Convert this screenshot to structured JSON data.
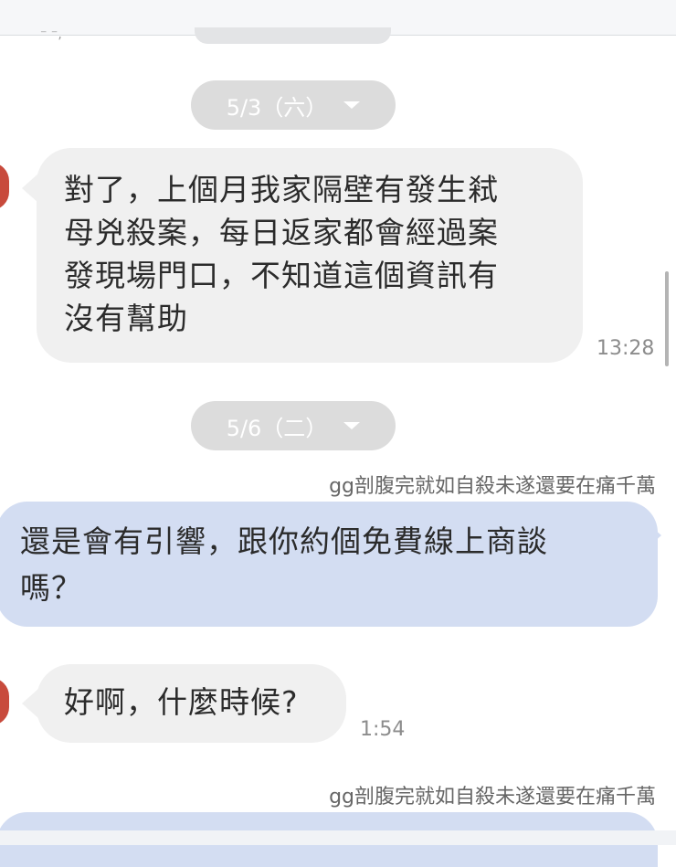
{
  "separators": [
    {
      "label": "5/3（六）"
    },
    {
      "label": "5/6（二）"
    }
  ],
  "messages": {
    "m1": {
      "lines": [
        "對了，上個月我家隔壁有發生弒",
        "母兇殺案，每日返家都會經過案",
        "發現場門口，不知道這個資訊有",
        "沒有幫助"
      ],
      "time": "13:28"
    },
    "m2": {
      "sender": "gg剖腹完就如自殺未遂還要在痛千萬",
      "lines": [
        "還是會有引響，跟你約個免費線上商談",
        "嗎？"
      ]
    },
    "m3": {
      "lines": [
        "好啊，什麼時候?"
      ],
      "time": "1:54"
    },
    "m4": {
      "sender": "gg剖腹完就如自殺未遂還要在痛千萬"
    }
  },
  "colors": {
    "incoming_bubble": "#f0f0f0",
    "outgoing_bubble": "#d3ddf2",
    "date_pill": "#dcdcdc",
    "avatar": "#c84a3c"
  }
}
